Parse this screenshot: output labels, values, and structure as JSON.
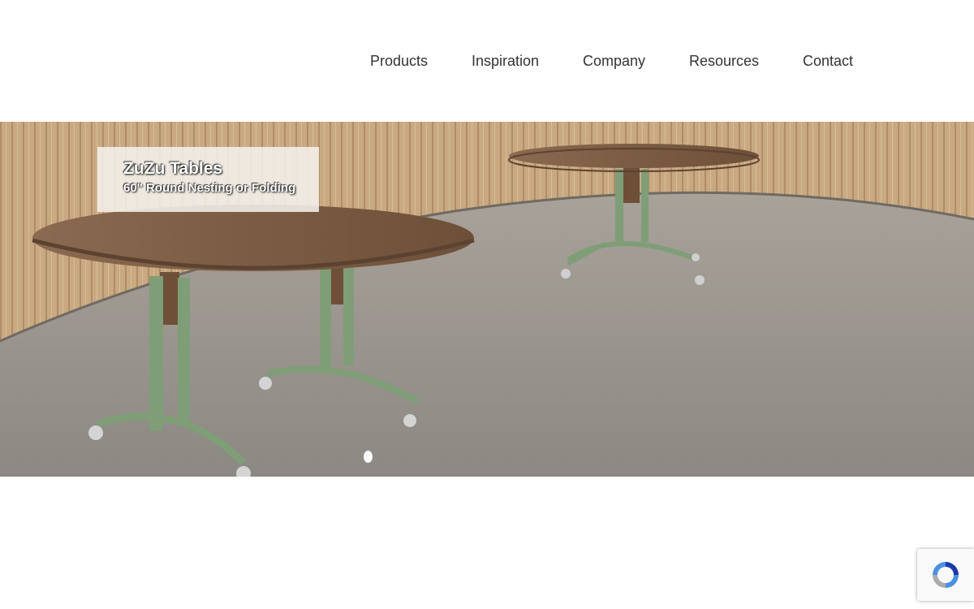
{
  "nav": {
    "items": [
      {
        "label": "Products"
      },
      {
        "label": "Inspiration"
      },
      {
        "label": "Company"
      },
      {
        "label": "Resources"
      },
      {
        "label": "Contact"
      }
    ]
  },
  "hero": {
    "title": "ZuZu Tables",
    "subtitle": "60\" Round Nesting or Folding",
    "slide_count": 1,
    "active_slide": 1
  },
  "colors": {
    "table_top": "#7b5c43",
    "frame_green": "#7f9e77",
    "floor": "#9a958e",
    "wall_wood": "#c8a77e",
    "recaptcha_blue": "#4a90e2"
  },
  "icons": {
    "recaptcha": "recaptcha-icon"
  }
}
